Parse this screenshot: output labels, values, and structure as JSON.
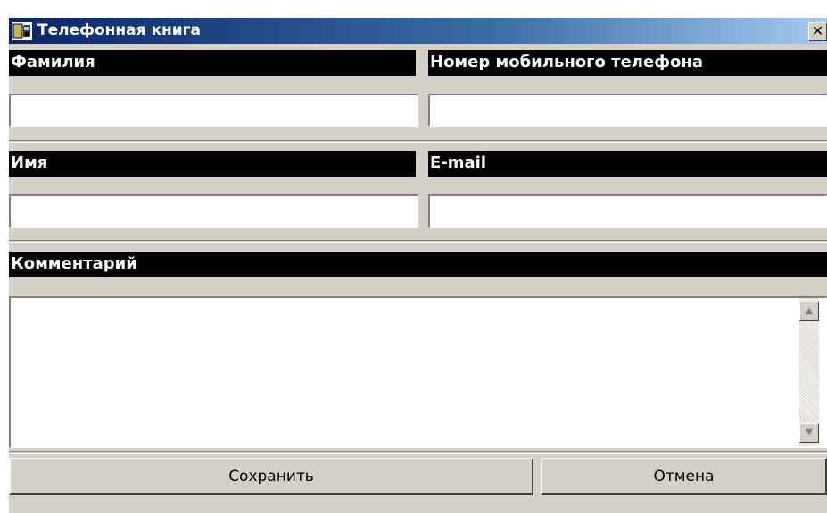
{
  "window": {
    "title": "Телефонная книга",
    "close_glyph": "✕"
  },
  "icons": {
    "app": "phone-book-icon",
    "close": "close-icon",
    "scroll_up": "arrow-up-icon",
    "scroll_down": "arrow-down-icon"
  },
  "fields": {
    "surname": {
      "label": "Фамилия",
      "value": ""
    },
    "mobile": {
      "label": "Номер мобильного телефона",
      "value": ""
    },
    "name": {
      "label": "Имя",
      "value": ""
    },
    "email": {
      "label": "E-mail",
      "value": ""
    },
    "comment": {
      "label": "Комментарий",
      "value": ""
    }
  },
  "buttons": {
    "save_label": "Сохранить",
    "cancel_label": "Отмена"
  },
  "scrollbar": {
    "up_glyph": "▲",
    "down_glyph": "▼"
  },
  "colors": {
    "title_gradient_start": "#0a246a",
    "title_gradient_end": "#a6caf0",
    "label_bar": "#000000",
    "dialog_face": "#d4d0c8"
  }
}
